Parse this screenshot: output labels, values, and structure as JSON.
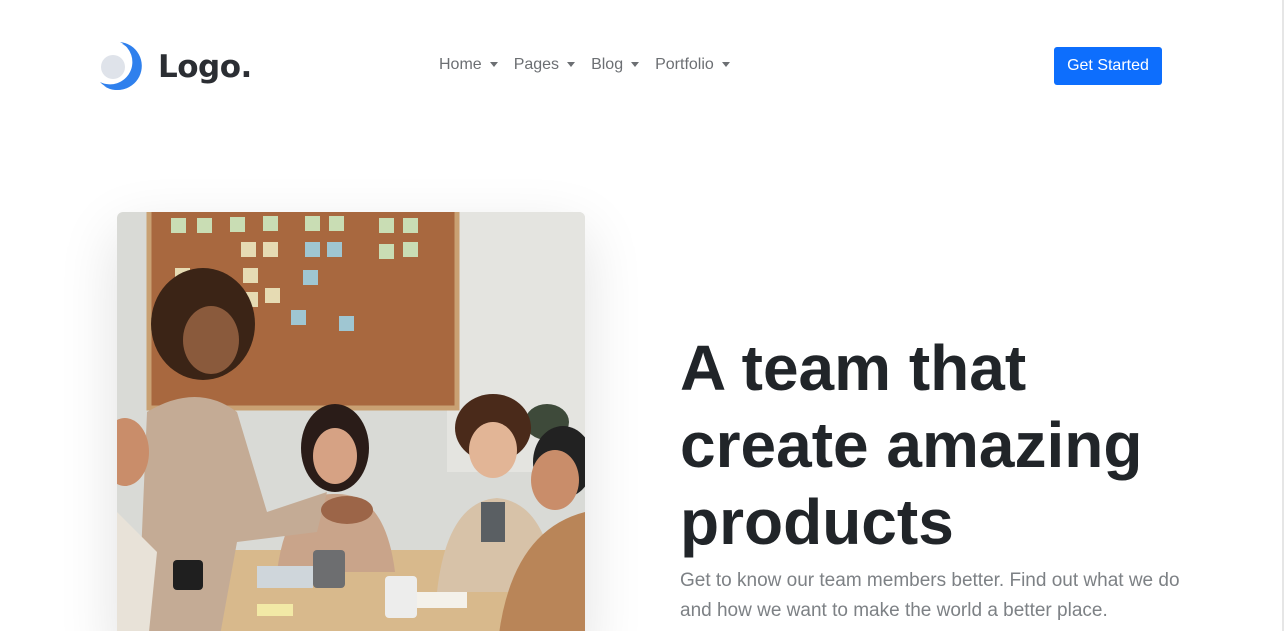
{
  "brand": {
    "name": "Logo.",
    "icon": "crescent-logo-icon",
    "accent": "#2f80ed"
  },
  "nav": {
    "items": [
      {
        "label": "Home"
      },
      {
        "label": "Pages"
      },
      {
        "label": "Blog"
      },
      {
        "label": "Portfolio"
      }
    ],
    "cta_label": "Get Started",
    "cta_color": "#0d6efd"
  },
  "hero": {
    "image_alt_subject": "team-meeting-photo",
    "title": "A team that create amazing products",
    "subtitle": "Get to know our team members better. Find out what we do and how we want to make the world a better place."
  }
}
